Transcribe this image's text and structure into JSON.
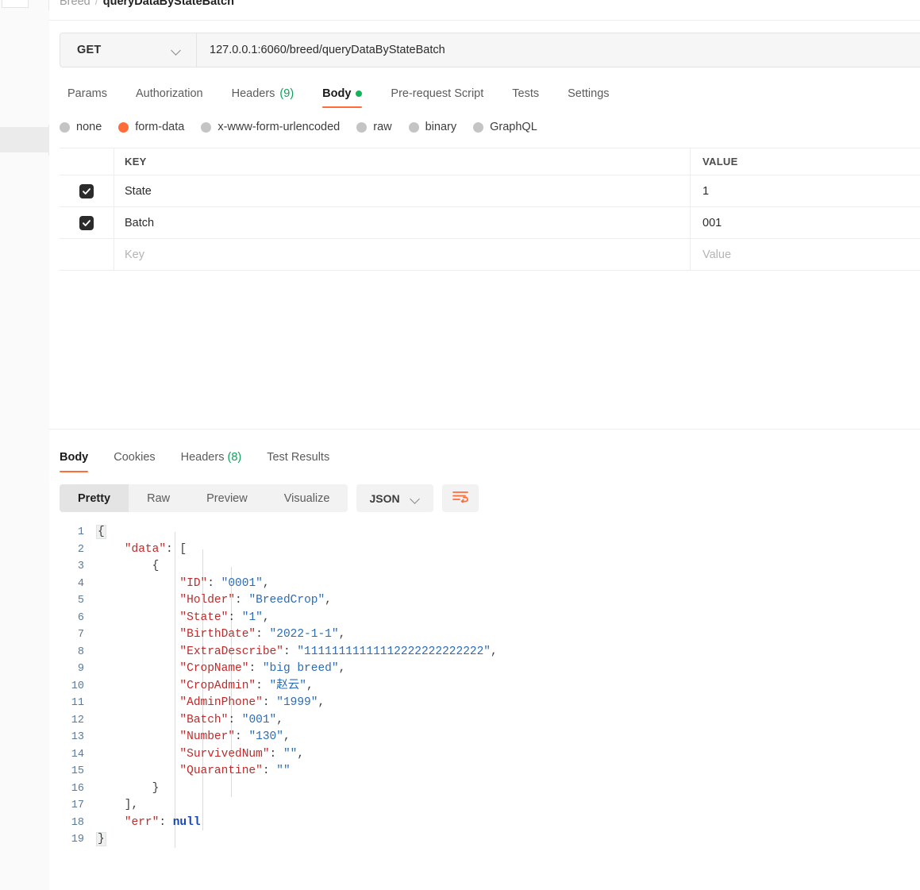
{
  "breadcrumb": {
    "folder": "Breed",
    "separator": "/",
    "current": "queryDataByStateBatch"
  },
  "request": {
    "method": "GET",
    "url": "127.0.0.1:6060/breed/queryDataByStateBatch",
    "tabs": [
      {
        "label": "Params",
        "count": "",
        "active": false,
        "dot": false
      },
      {
        "label": "Authorization",
        "count": "",
        "active": false,
        "dot": false
      },
      {
        "label": "Headers",
        "count": "(9)",
        "active": false,
        "dot": false
      },
      {
        "label": "Body",
        "count": "",
        "active": true,
        "dot": true
      },
      {
        "label": "Pre-request Script",
        "count": "",
        "active": false,
        "dot": false
      },
      {
        "label": "Tests",
        "count": "",
        "active": false,
        "dot": false
      },
      {
        "label": "Settings",
        "count": "",
        "active": false,
        "dot": false
      }
    ],
    "body_types": [
      {
        "label": "none",
        "selected": false
      },
      {
        "label": "form-data",
        "selected": true
      },
      {
        "label": "x-www-form-urlencoded",
        "selected": false
      },
      {
        "label": "raw",
        "selected": false
      },
      {
        "label": "binary",
        "selected": false
      },
      {
        "label": "GraphQL",
        "selected": false
      }
    ],
    "table": {
      "headers": {
        "key": "KEY",
        "value": "VALUE"
      },
      "rows": [
        {
          "checked": true,
          "key": "State",
          "value": "1",
          "placeholder": false
        },
        {
          "checked": true,
          "key": "Batch",
          "value": "001",
          "placeholder": false
        },
        {
          "checked": false,
          "key": "Key",
          "value": "Value",
          "placeholder": true
        }
      ]
    }
  },
  "response": {
    "tabs": [
      {
        "label": "Body",
        "count": "",
        "active": true
      },
      {
        "label": "Cookies",
        "count": "",
        "active": false
      },
      {
        "label": "Headers",
        "count": "(8)",
        "active": false
      },
      {
        "label": "Test Results",
        "count": "",
        "active": false
      }
    ],
    "views": [
      {
        "label": "Pretty",
        "active": true
      },
      {
        "label": "Raw",
        "active": false
      },
      {
        "label": "Preview",
        "active": false
      },
      {
        "label": "Visualize",
        "active": false
      }
    ],
    "language": "JSON",
    "wrap_icon": "word-wrap-icon",
    "json_lines": [
      {
        "n": "1",
        "segs": [
          {
            "t": "{",
            "c": "brace-hl p"
          }
        ]
      },
      {
        "n": "2",
        "segs": [
          {
            "t": "    ",
            "c": "p"
          },
          {
            "t": "\"data\"",
            "c": "k"
          },
          {
            "t": ": [",
            "c": "p"
          }
        ]
      },
      {
        "n": "3",
        "segs": [
          {
            "t": "        {",
            "c": "p"
          }
        ]
      },
      {
        "n": "4",
        "segs": [
          {
            "t": "            ",
            "c": "p"
          },
          {
            "t": "\"ID\"",
            "c": "k"
          },
          {
            "t": ": ",
            "c": "p"
          },
          {
            "t": "\"0001\"",
            "c": "s"
          },
          {
            "t": ",",
            "c": "p"
          }
        ]
      },
      {
        "n": "5",
        "segs": [
          {
            "t": "            ",
            "c": "p"
          },
          {
            "t": "\"Holder\"",
            "c": "k"
          },
          {
            "t": ": ",
            "c": "p"
          },
          {
            "t": "\"BreedCrop\"",
            "c": "s"
          },
          {
            "t": ",",
            "c": "p"
          }
        ]
      },
      {
        "n": "6",
        "segs": [
          {
            "t": "            ",
            "c": "p"
          },
          {
            "t": "\"State\"",
            "c": "k"
          },
          {
            "t": ": ",
            "c": "p"
          },
          {
            "t": "\"1\"",
            "c": "s"
          },
          {
            "t": ",",
            "c": "p"
          }
        ]
      },
      {
        "n": "7",
        "segs": [
          {
            "t": "            ",
            "c": "p"
          },
          {
            "t": "\"BirthDate\"",
            "c": "k"
          },
          {
            "t": ": ",
            "c": "p"
          },
          {
            "t": "\"2022-1-1\"",
            "c": "s"
          },
          {
            "t": ",",
            "c": "p"
          }
        ]
      },
      {
        "n": "8",
        "segs": [
          {
            "t": "            ",
            "c": "p"
          },
          {
            "t": "\"ExtraDescribe\"",
            "c": "k"
          },
          {
            "t": ": ",
            "c": "p"
          },
          {
            "t": "\"11111111111112222222222222\"",
            "c": "s"
          },
          {
            "t": ",",
            "c": "p"
          }
        ]
      },
      {
        "n": "9",
        "segs": [
          {
            "t": "            ",
            "c": "p"
          },
          {
            "t": "\"CropName\"",
            "c": "k"
          },
          {
            "t": ": ",
            "c": "p"
          },
          {
            "t": "\"big breed\"",
            "c": "s"
          },
          {
            "t": ",",
            "c": "p"
          }
        ]
      },
      {
        "n": "10",
        "segs": [
          {
            "t": "            ",
            "c": "p"
          },
          {
            "t": "\"CropAdmin\"",
            "c": "k"
          },
          {
            "t": ": ",
            "c": "p"
          },
          {
            "t": "\"赵云\"",
            "c": "s"
          },
          {
            "t": ",",
            "c": "p"
          }
        ]
      },
      {
        "n": "11",
        "segs": [
          {
            "t": "            ",
            "c": "p"
          },
          {
            "t": "\"AdminPhone\"",
            "c": "k"
          },
          {
            "t": ": ",
            "c": "p"
          },
          {
            "t": "\"1999\"",
            "c": "s"
          },
          {
            "t": ",",
            "c": "p"
          }
        ]
      },
      {
        "n": "12",
        "segs": [
          {
            "t": "            ",
            "c": "p"
          },
          {
            "t": "\"Batch\"",
            "c": "k"
          },
          {
            "t": ": ",
            "c": "p"
          },
          {
            "t": "\"001\"",
            "c": "s"
          },
          {
            "t": ",",
            "c": "p"
          }
        ]
      },
      {
        "n": "13",
        "segs": [
          {
            "t": "            ",
            "c": "p"
          },
          {
            "t": "\"Number\"",
            "c": "k"
          },
          {
            "t": ": ",
            "c": "p"
          },
          {
            "t": "\"130\"",
            "c": "s"
          },
          {
            "t": ",",
            "c": "p"
          }
        ]
      },
      {
        "n": "14",
        "segs": [
          {
            "t": "            ",
            "c": "p"
          },
          {
            "t": "\"SurvivedNum\"",
            "c": "k"
          },
          {
            "t": ": ",
            "c": "p"
          },
          {
            "t": "\"\"",
            "c": "s"
          },
          {
            "t": ",",
            "c": "p"
          }
        ]
      },
      {
        "n": "15",
        "segs": [
          {
            "t": "            ",
            "c": "p"
          },
          {
            "t": "\"Quarantine\"",
            "c": "k"
          },
          {
            "t": ": ",
            "c": "p"
          },
          {
            "t": "\"\"",
            "c": "s"
          }
        ]
      },
      {
        "n": "16",
        "segs": [
          {
            "t": "        }",
            "c": "p"
          }
        ]
      },
      {
        "n": "17",
        "segs": [
          {
            "t": "    ],",
            "c": "p"
          }
        ]
      },
      {
        "n": "18",
        "segs": [
          {
            "t": "    ",
            "c": "p"
          },
          {
            "t": "\"err\"",
            "c": "k"
          },
          {
            "t": ": ",
            "c": "p"
          },
          {
            "t": "null",
            "c": "nul"
          }
        ]
      },
      {
        "n": "19",
        "segs": [
          {
            "t": "}",
            "c": "brace-hl p"
          }
        ]
      }
    ]
  },
  "colors": {
    "accent": "#ff6c37",
    "success": "#15b357",
    "key": "#bf2b2b",
    "string": "#2b6cb8",
    "checkbox": "#2b2b2b"
  }
}
